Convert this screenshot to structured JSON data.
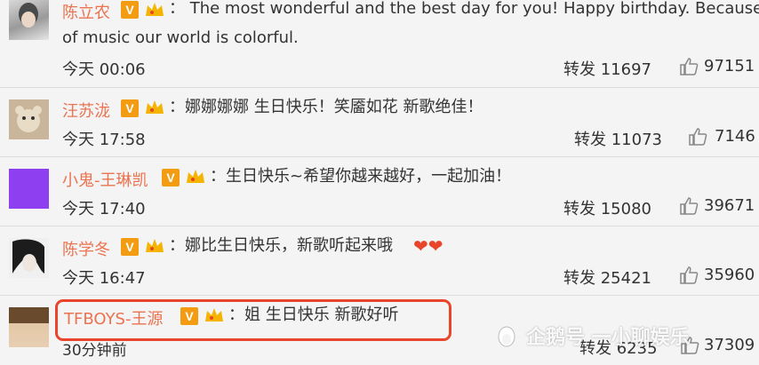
{
  "comments": [
    {
      "name": "陈立农",
      "text_lines": [
        "： The most wonderful  and the best day for you! Happy birthday. Because",
        "of music our world is colorful."
      ],
      "time": "今天 00:06",
      "repost": "转发 11697",
      "likes": "97151"
    },
    {
      "name": "汪苏泷",
      "text_lines": [
        "：娜娜娜娜 生日快乐！笑靥如花 新歌绝佳！"
      ],
      "time": "今天 17:58",
      "repost": "转发 11073",
      "likes": "7146"
    },
    {
      "name": "小鬼-王琳凯",
      "text_lines": [
        "：生日快乐~希望你越来越好，一起加油！"
      ],
      "time": "今天 17:40",
      "repost": "转发 15080",
      "likes": "39671"
    },
    {
      "name": "陈学冬",
      "text_lines": [
        "：娜比生日快乐，新歌听起来哦"
      ],
      "hearts": "❤❤",
      "time": "今天 16:47",
      "repost": "转发 25421",
      "likes": "35960"
    },
    {
      "name": "TFBOYS-王源",
      "text_lines": [
        "：姐 生日快乐 新歌好听"
      ],
      "time": "30分钟前",
      "repost": "转发 6235",
      "likes": "37309"
    }
  ],
  "badges": {
    "verified_letter": "V"
  },
  "watermark": {
    "text": "企鹅号 一小聊娱乐"
  },
  "colors": {
    "name": "#eb7350",
    "highlight": "#e8452c",
    "badge": "#f39c12"
  }
}
